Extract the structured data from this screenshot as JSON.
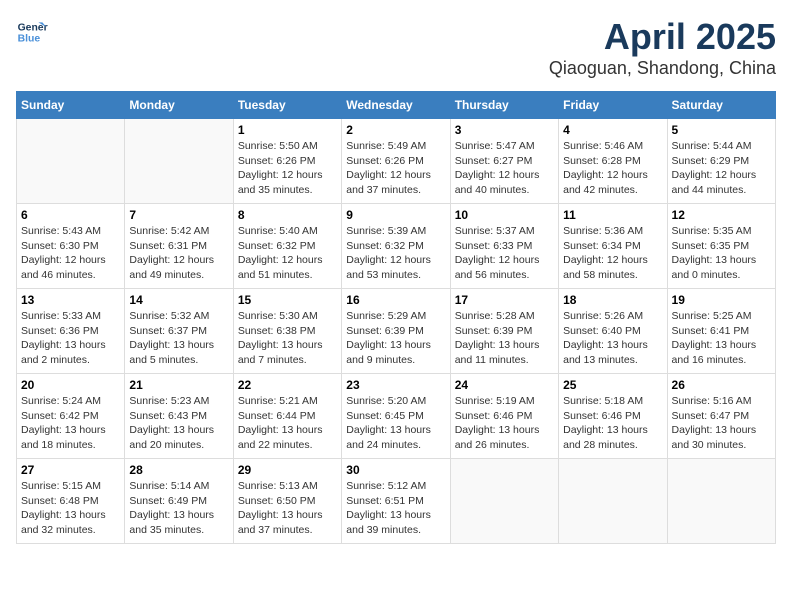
{
  "header": {
    "logo_line1": "General",
    "logo_line2": "Blue",
    "title": "April 2025",
    "subtitle": "Qiaoguan, Shandong, China"
  },
  "days_of_week": [
    "Sunday",
    "Monday",
    "Tuesday",
    "Wednesday",
    "Thursday",
    "Friday",
    "Saturday"
  ],
  "weeks": [
    [
      {
        "day": null
      },
      {
        "day": null
      },
      {
        "day": "1",
        "sunrise": "Sunrise: 5:50 AM",
        "sunset": "Sunset: 6:26 PM",
        "daylight": "Daylight: 12 hours and 35 minutes."
      },
      {
        "day": "2",
        "sunrise": "Sunrise: 5:49 AM",
        "sunset": "Sunset: 6:26 PM",
        "daylight": "Daylight: 12 hours and 37 minutes."
      },
      {
        "day": "3",
        "sunrise": "Sunrise: 5:47 AM",
        "sunset": "Sunset: 6:27 PM",
        "daylight": "Daylight: 12 hours and 40 minutes."
      },
      {
        "day": "4",
        "sunrise": "Sunrise: 5:46 AM",
        "sunset": "Sunset: 6:28 PM",
        "daylight": "Daylight: 12 hours and 42 minutes."
      },
      {
        "day": "5",
        "sunrise": "Sunrise: 5:44 AM",
        "sunset": "Sunset: 6:29 PM",
        "daylight": "Daylight: 12 hours and 44 minutes."
      }
    ],
    [
      {
        "day": "6",
        "sunrise": "Sunrise: 5:43 AM",
        "sunset": "Sunset: 6:30 PM",
        "daylight": "Daylight: 12 hours and 46 minutes."
      },
      {
        "day": "7",
        "sunrise": "Sunrise: 5:42 AM",
        "sunset": "Sunset: 6:31 PM",
        "daylight": "Daylight: 12 hours and 49 minutes."
      },
      {
        "day": "8",
        "sunrise": "Sunrise: 5:40 AM",
        "sunset": "Sunset: 6:32 PM",
        "daylight": "Daylight: 12 hours and 51 minutes."
      },
      {
        "day": "9",
        "sunrise": "Sunrise: 5:39 AM",
        "sunset": "Sunset: 6:32 PM",
        "daylight": "Daylight: 12 hours and 53 minutes."
      },
      {
        "day": "10",
        "sunrise": "Sunrise: 5:37 AM",
        "sunset": "Sunset: 6:33 PM",
        "daylight": "Daylight: 12 hours and 56 minutes."
      },
      {
        "day": "11",
        "sunrise": "Sunrise: 5:36 AM",
        "sunset": "Sunset: 6:34 PM",
        "daylight": "Daylight: 12 hours and 58 minutes."
      },
      {
        "day": "12",
        "sunrise": "Sunrise: 5:35 AM",
        "sunset": "Sunset: 6:35 PM",
        "daylight": "Daylight: 13 hours and 0 minutes."
      }
    ],
    [
      {
        "day": "13",
        "sunrise": "Sunrise: 5:33 AM",
        "sunset": "Sunset: 6:36 PM",
        "daylight": "Daylight: 13 hours and 2 minutes."
      },
      {
        "day": "14",
        "sunrise": "Sunrise: 5:32 AM",
        "sunset": "Sunset: 6:37 PM",
        "daylight": "Daylight: 13 hours and 5 minutes."
      },
      {
        "day": "15",
        "sunrise": "Sunrise: 5:30 AM",
        "sunset": "Sunset: 6:38 PM",
        "daylight": "Daylight: 13 hours and 7 minutes."
      },
      {
        "day": "16",
        "sunrise": "Sunrise: 5:29 AM",
        "sunset": "Sunset: 6:39 PM",
        "daylight": "Daylight: 13 hours and 9 minutes."
      },
      {
        "day": "17",
        "sunrise": "Sunrise: 5:28 AM",
        "sunset": "Sunset: 6:39 PM",
        "daylight": "Daylight: 13 hours and 11 minutes."
      },
      {
        "day": "18",
        "sunrise": "Sunrise: 5:26 AM",
        "sunset": "Sunset: 6:40 PM",
        "daylight": "Daylight: 13 hours and 13 minutes."
      },
      {
        "day": "19",
        "sunrise": "Sunrise: 5:25 AM",
        "sunset": "Sunset: 6:41 PM",
        "daylight": "Daylight: 13 hours and 16 minutes."
      }
    ],
    [
      {
        "day": "20",
        "sunrise": "Sunrise: 5:24 AM",
        "sunset": "Sunset: 6:42 PM",
        "daylight": "Daylight: 13 hours and 18 minutes."
      },
      {
        "day": "21",
        "sunrise": "Sunrise: 5:23 AM",
        "sunset": "Sunset: 6:43 PM",
        "daylight": "Daylight: 13 hours and 20 minutes."
      },
      {
        "day": "22",
        "sunrise": "Sunrise: 5:21 AM",
        "sunset": "Sunset: 6:44 PM",
        "daylight": "Daylight: 13 hours and 22 minutes."
      },
      {
        "day": "23",
        "sunrise": "Sunrise: 5:20 AM",
        "sunset": "Sunset: 6:45 PM",
        "daylight": "Daylight: 13 hours and 24 minutes."
      },
      {
        "day": "24",
        "sunrise": "Sunrise: 5:19 AM",
        "sunset": "Sunset: 6:46 PM",
        "daylight": "Daylight: 13 hours and 26 minutes."
      },
      {
        "day": "25",
        "sunrise": "Sunrise: 5:18 AM",
        "sunset": "Sunset: 6:46 PM",
        "daylight": "Daylight: 13 hours and 28 minutes."
      },
      {
        "day": "26",
        "sunrise": "Sunrise: 5:16 AM",
        "sunset": "Sunset: 6:47 PM",
        "daylight": "Daylight: 13 hours and 30 minutes."
      }
    ],
    [
      {
        "day": "27",
        "sunrise": "Sunrise: 5:15 AM",
        "sunset": "Sunset: 6:48 PM",
        "daylight": "Daylight: 13 hours and 32 minutes."
      },
      {
        "day": "28",
        "sunrise": "Sunrise: 5:14 AM",
        "sunset": "Sunset: 6:49 PM",
        "daylight": "Daylight: 13 hours and 35 minutes."
      },
      {
        "day": "29",
        "sunrise": "Sunrise: 5:13 AM",
        "sunset": "Sunset: 6:50 PM",
        "daylight": "Daylight: 13 hours and 37 minutes."
      },
      {
        "day": "30",
        "sunrise": "Sunrise: 5:12 AM",
        "sunset": "Sunset: 6:51 PM",
        "daylight": "Daylight: 13 hours and 39 minutes."
      },
      {
        "day": null
      },
      {
        "day": null
      },
      {
        "day": null
      }
    ]
  ]
}
